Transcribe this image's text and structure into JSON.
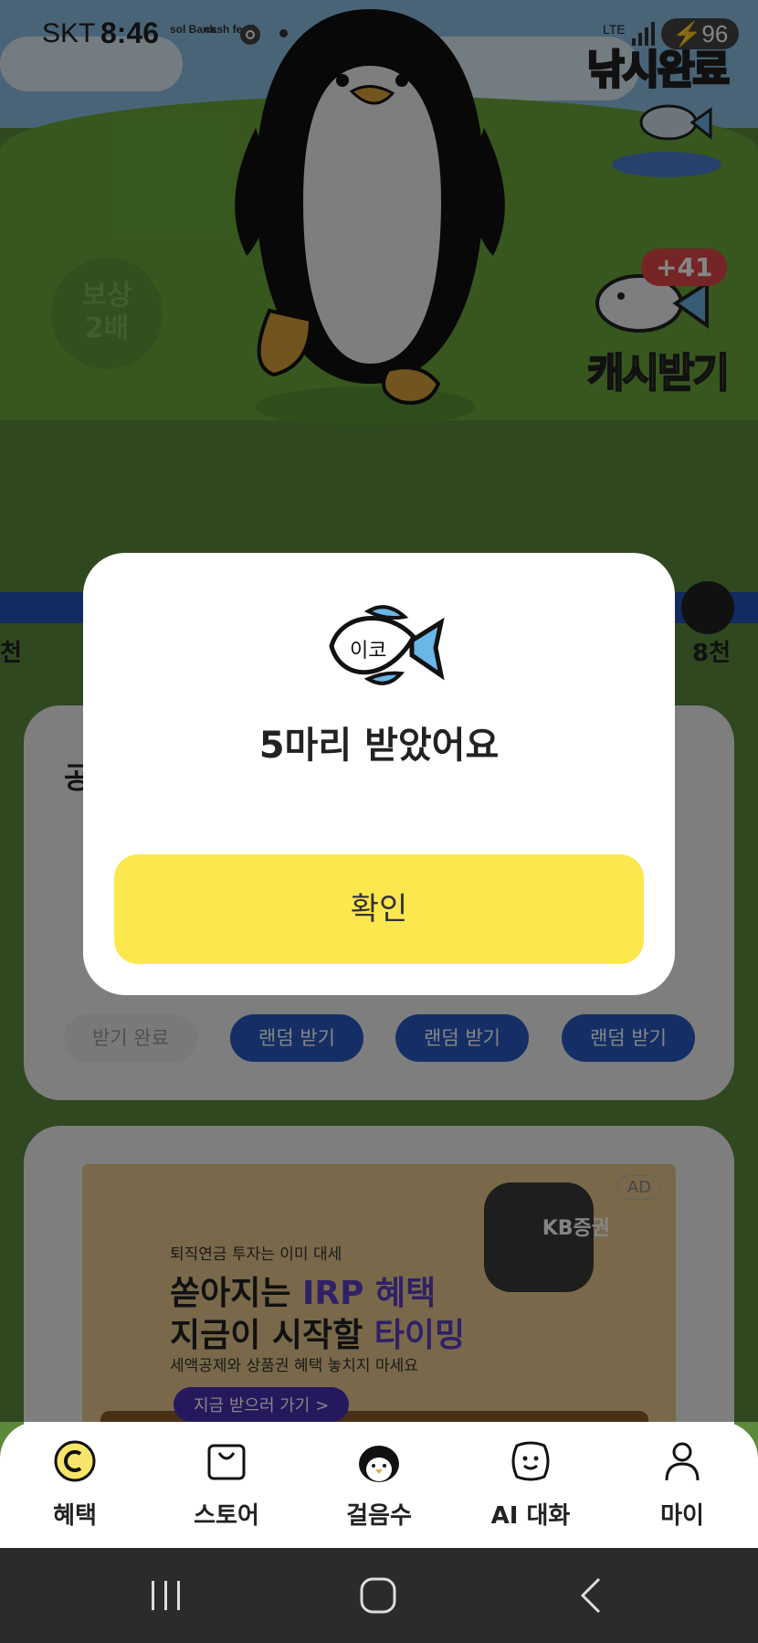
{
  "status_bar": {
    "carrier": "SKT",
    "time": "8:46",
    "app_icons": [
      "sol Bank",
      "cash feed"
    ],
    "network": "LTE",
    "battery": "96"
  },
  "scene": {
    "reward_badge_line1": "보상",
    "reward_badge_line2": "2배",
    "fishing_done_label": "낚시완료",
    "cash_badge": "+41",
    "cash_label": "캐시받기",
    "progress_left": "천",
    "progress_right": "8천"
  },
  "mission_card": {
    "title": "공",
    "buttons": [
      {
        "label": "받기 완료",
        "state": "done"
      },
      {
        "label": "랜덤 받기",
        "state": "active"
      },
      {
        "label": "랜덤 받기",
        "state": "active"
      },
      {
        "label": "랜덤 받기",
        "state": "active"
      }
    ]
  },
  "ad": {
    "tag": "AD",
    "brand": "KB증권",
    "line1": "퇴직연금 투자는 이미 대세",
    "line2_a": "쏟아지는 ",
    "line2_b": "IRP 혜택",
    "line3_a": "지금이 시작할 ",
    "line3_b": "타이밍",
    "line4": "세액공제와 상품권 혜택 놓치지 마세요",
    "cta": "지금 받으러 가기 >"
  },
  "modal": {
    "fish_text": "이코",
    "message": "5마리 받았어요",
    "confirm_label": "확인"
  },
  "bottom_nav": {
    "items": [
      {
        "label": "혜택",
        "icon": "coin-icon"
      },
      {
        "label": "스토어",
        "icon": "shopping-bag-icon"
      },
      {
        "label": "걸음수",
        "icon": "penguin-icon"
      },
      {
        "label": "AI 대화",
        "icon": "smile-chat-icon"
      },
      {
        "label": "마이",
        "icon": "person-icon"
      }
    ]
  },
  "colors": {
    "accent_yellow": "#fce74f",
    "button_blue": "#2a5bc4",
    "grass": "#6aa83b"
  }
}
